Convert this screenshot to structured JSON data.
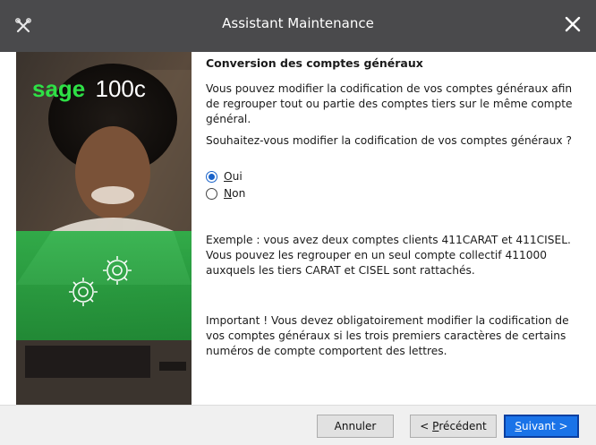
{
  "window": {
    "title": "Assistant Maintenance",
    "app_icon": "wrench-tools-icon",
    "close_icon": "close-icon"
  },
  "side_panel": {
    "brand_sage": "sage",
    "brand_product": "100c",
    "brand_color": "#2ee046",
    "overlay_color": "#2fb34a"
  },
  "content": {
    "heading": "Conversion des comptes généraux",
    "intro": "Vous pouvez modifier la codification de vos comptes généraux afin de regrouper tout ou partie des comptes tiers sur le même compte général.",
    "question": "Souhaitez-vous modifier la codification de vos comptes généraux ?",
    "options": [
      {
        "label": "Oui",
        "mnemonic": "O",
        "rest": "ui",
        "selected": true
      },
      {
        "label": "Non",
        "mnemonic": "N",
        "rest": "on",
        "selected": false
      }
    ],
    "example": "Exemple : vous avez deux comptes clients 411CARAT et 411CISEL. Vous pouvez les regrouper en un seul compte collectif 411000 auxquels les tiers CARAT et CISEL sont rattachés.",
    "important": "Important ! Vous devez obligatoirement modifier la codification de vos comptes généraux si les trois premiers caractères de certains numéros de compte comportent des lettres."
  },
  "footer": {
    "cancel_label": "Annuler",
    "prev_prefix": "< ",
    "prev_mnemonic": "P",
    "prev_rest": "récédent",
    "next_mnemonic": "S",
    "next_rest": "uivant >"
  },
  "colors": {
    "titlebar": "#4a4a4c",
    "primary_button": "#1a73e8",
    "radio_selected": "#1a63c9"
  }
}
